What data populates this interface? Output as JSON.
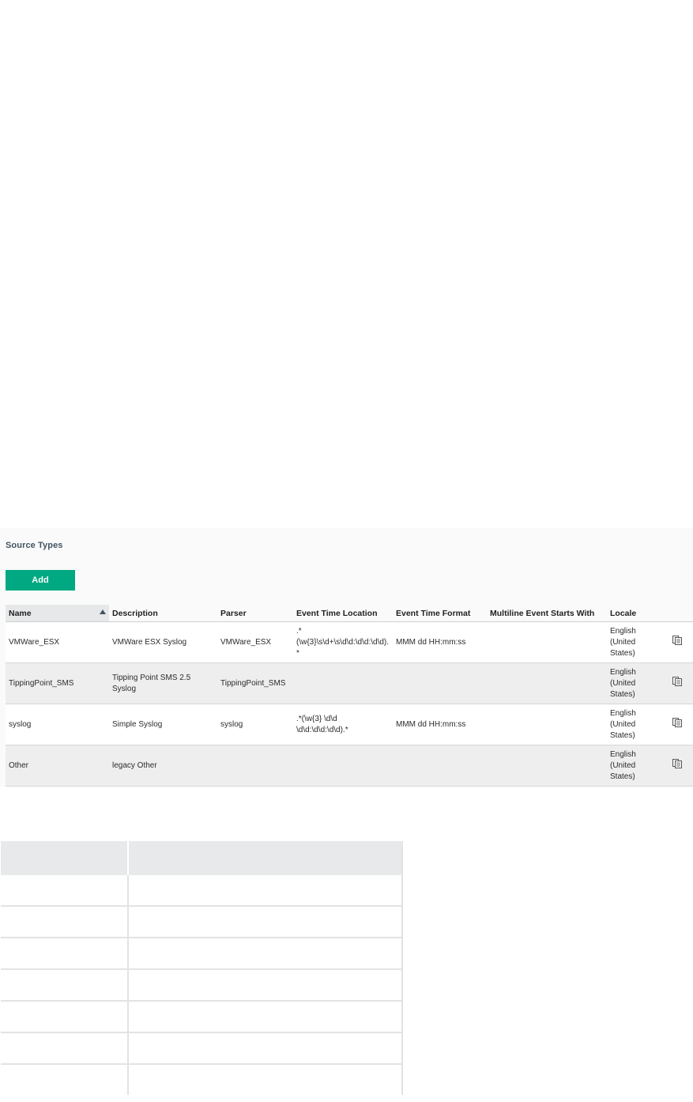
{
  "panel": {
    "title": "Source Types",
    "add_label": "Add"
  },
  "table": {
    "columns": [
      "Name",
      "Description",
      "Parser",
      "Event Time Location",
      "Event Time Format",
      "Multiline Event Starts With",
      "Locale"
    ],
    "sorted_column": "Name",
    "sort_direction": "ascending",
    "rows": [
      {
        "name": "VMWare_ESX",
        "description": "VMWare ESX Syslog",
        "parser": "VMWare_ESX",
        "event_time_location": ".*(\\w{3}\\s\\d+\\s\\d\\d:\\d\\d:\\d\\d).*",
        "event_time_format": "MMM dd HH:mm:ss",
        "multiline": "",
        "locale": "English (United States)",
        "action_icon": "copy-icon"
      },
      {
        "name": "TippingPoint_SMS",
        "description": "Tipping Point SMS 2.5 Syslog",
        "parser": "TippingPoint_SMS",
        "event_time_location": "",
        "event_time_format": "",
        "multiline": "",
        "locale": "English (United States)",
        "action_icon": "copy-icon"
      },
      {
        "name": "syslog",
        "description": "Simple Syslog",
        "parser": "syslog",
        "event_time_location": ".*(\\w{3} \\d\\d \\d\\d:\\d\\d:\\d\\d).*",
        "event_time_format": "MMM dd HH:mm:ss",
        "multiline": "",
        "locale": "English (United States)",
        "action_icon": "copy-icon"
      },
      {
        "name": "Other",
        "description": "legacy Other",
        "parser": "",
        "event_time_location": "",
        "event_time_format": "",
        "multiline": "",
        "locale": "English (United States)",
        "action_icon": "copy-icon"
      }
    ]
  },
  "colors": {
    "accent": "#01a982",
    "title": "#425563",
    "row_alt": "#eeeeee",
    "header_sorted": "#e6e8e9"
  }
}
